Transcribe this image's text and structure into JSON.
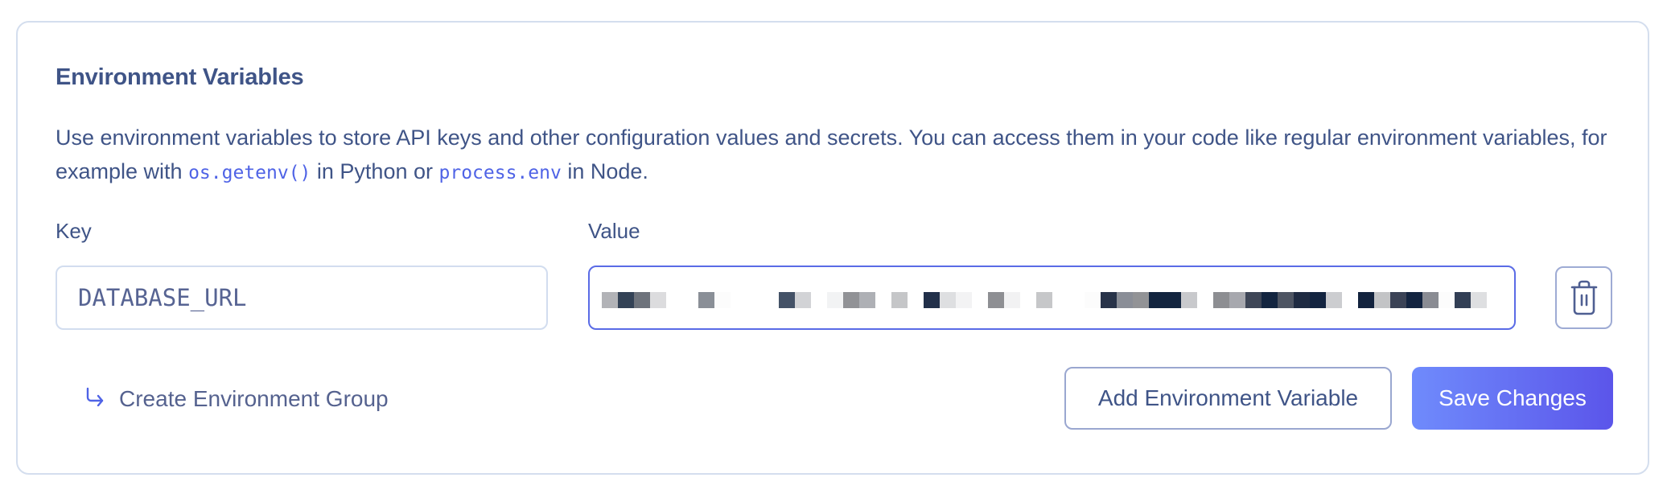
{
  "section": {
    "title": "Environment Variables",
    "description": {
      "part1": "Use environment variables to store API keys and other configuration values and secrets. You can access them in your code like regular environment variables, for example with ",
      "code1": "os.getenv()",
      "part2": " in Python or ",
      "code2": "process.env",
      "part3": " in Node."
    }
  },
  "fields": {
    "key_label": "Key",
    "value_label": "Value",
    "key_value": "DATABASE_URL",
    "value_redacted": true,
    "value_redaction_colors": [
      "#b2b3b7",
      "#334256",
      "#6e737c",
      "#dcdcde",
      null,
      null,
      "#8a8f97",
      "#fcfcfc",
      null,
      null,
      null,
      "#445267",
      "#d2d3d6",
      null,
      "#f2f3f4",
      "#919296",
      "#aeb0b5",
      null,
      "#c5c6c8",
      null,
      "#22304a",
      "#dedfe1",
      "#f3f3f4",
      null,
      "#8e8f93",
      "#f2f2f3",
      null,
      "#c6c7c9",
      null,
      null,
      "#fcfcfc",
      "#283349",
      "#8a8e97",
      "#929396",
      "#13253f",
      "#13253f",
      "#c8c9cc",
      null,
      "#8d8e92",
      "#a7a8ae",
      "#3e4657",
      "#132540",
      "#4e5563",
      "#1f2b42",
      "#132440",
      "#cccdd0",
      null,
      "#13233e",
      "#c3c4c6",
      "#3b4356",
      "#132440",
      "#8a8c93",
      "#fcfcfc",
      "#323f55",
      "#dedfe1"
    ],
    "delete_icon": "trash-icon"
  },
  "actions": {
    "create_group_icon": "arrow-return-right-icon",
    "create_group_label": "Create Environment Group",
    "add_variable_label": "Add Environment Variable",
    "save_label": "Save Changes"
  },
  "colors": {
    "text": "#3f5487",
    "accent": "#4f63e6",
    "save_gradient_start": "#6f8bfc",
    "save_gradient_end": "#5b55ea",
    "card_border": "#d4deee"
  }
}
